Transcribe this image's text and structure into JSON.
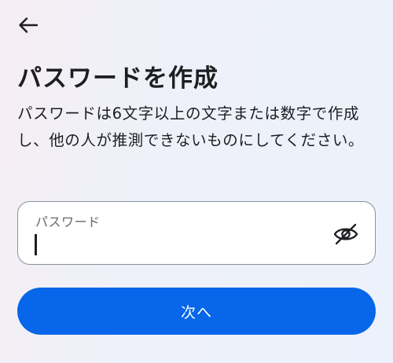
{
  "header": {
    "back_icon": "arrow-left-icon"
  },
  "page": {
    "title": "パスワードを作成",
    "description": "パスワードは6文字以上の文字または数字で作成し、他の人が推測できないものにしてください。"
  },
  "password_field": {
    "label": "パスワード",
    "value": "",
    "visibility_icon": "eye-off-icon"
  },
  "actions": {
    "next_label": "次へ"
  },
  "colors": {
    "primary": "#0766e9",
    "text": "#1c1e21",
    "muted": "#65676b",
    "border": "#8a929c"
  }
}
